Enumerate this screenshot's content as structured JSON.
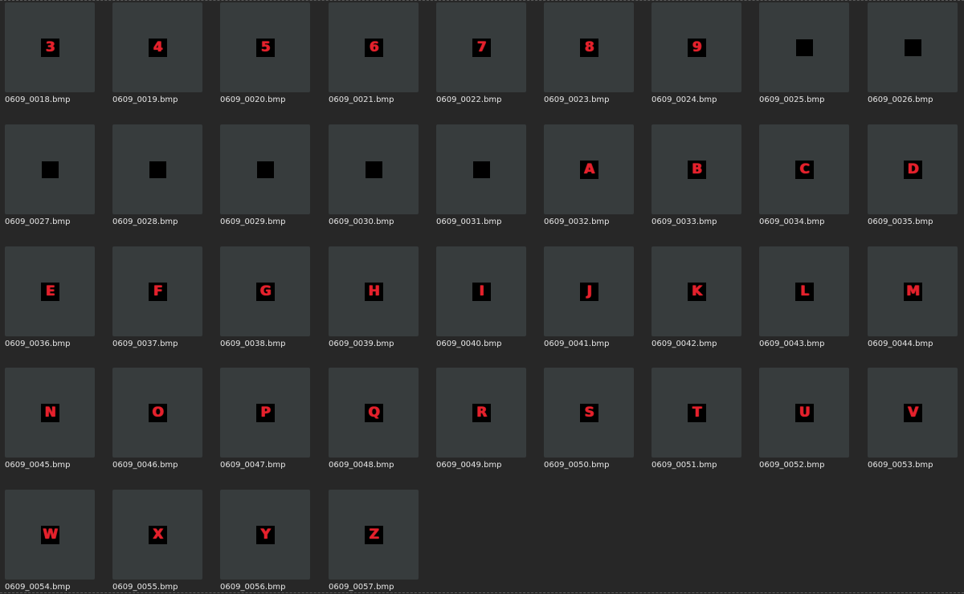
{
  "files": [
    {
      "name": "0609_0018.bmp",
      "glyph": "3"
    },
    {
      "name": "0609_0019.bmp",
      "glyph": "4"
    },
    {
      "name": "0609_0020.bmp",
      "glyph": "5"
    },
    {
      "name": "0609_0021.bmp",
      "glyph": "6"
    },
    {
      "name": "0609_0022.bmp",
      "glyph": "7"
    },
    {
      "name": "0609_0023.bmp",
      "glyph": "8"
    },
    {
      "name": "0609_0024.bmp",
      "glyph": "9"
    },
    {
      "name": "0609_0025.bmp",
      "glyph": ""
    },
    {
      "name": "0609_0026.bmp",
      "glyph": ""
    },
    {
      "name": "0609_0027.bmp",
      "glyph": ""
    },
    {
      "name": "0609_0028.bmp",
      "glyph": ""
    },
    {
      "name": "0609_0029.bmp",
      "glyph": ""
    },
    {
      "name": "0609_0030.bmp",
      "glyph": ""
    },
    {
      "name": "0609_0031.bmp",
      "glyph": ""
    },
    {
      "name": "0609_0032.bmp",
      "glyph": "A"
    },
    {
      "name": "0609_0033.bmp",
      "glyph": "B"
    },
    {
      "name": "0609_0034.bmp",
      "glyph": "C"
    },
    {
      "name": "0609_0035.bmp",
      "glyph": "D"
    },
    {
      "name": "0609_0036.bmp",
      "glyph": "E"
    },
    {
      "name": "0609_0037.bmp",
      "glyph": "F"
    },
    {
      "name": "0609_0038.bmp",
      "glyph": "G"
    },
    {
      "name": "0609_0039.bmp",
      "glyph": "H"
    },
    {
      "name": "0609_0040.bmp",
      "glyph": "I"
    },
    {
      "name": "0609_0041.bmp",
      "glyph": "J"
    },
    {
      "name": "0609_0042.bmp",
      "glyph": "K"
    },
    {
      "name": "0609_0043.bmp",
      "glyph": "L"
    },
    {
      "name": "0609_0044.bmp",
      "glyph": "M"
    },
    {
      "name": "0609_0045.bmp",
      "glyph": "N"
    },
    {
      "name": "0609_0046.bmp",
      "glyph": "O"
    },
    {
      "name": "0609_0047.bmp",
      "glyph": "P"
    },
    {
      "name": "0609_0048.bmp",
      "glyph": "Q"
    },
    {
      "name": "0609_0049.bmp",
      "glyph": "R"
    },
    {
      "name": "0609_0050.bmp",
      "glyph": "S"
    },
    {
      "name": "0609_0051.bmp",
      "glyph": "T"
    },
    {
      "name": "0609_0052.bmp",
      "glyph": "U"
    },
    {
      "name": "0609_0053.bmp",
      "glyph": "V"
    },
    {
      "name": "0609_0054.bmp",
      "glyph": "W"
    },
    {
      "name": "0609_0055.bmp",
      "glyph": "X"
    },
    {
      "name": "0609_0056.bmp",
      "glyph": "Y"
    },
    {
      "name": "0609_0057.bmp",
      "glyph": "Z"
    }
  ],
  "colors": {
    "background": "#272727",
    "thumbnail": "#373c3d",
    "glyph_ink": "#e5202c",
    "glyph_bg": "#000000",
    "filename_text": "#e6e6e6"
  }
}
